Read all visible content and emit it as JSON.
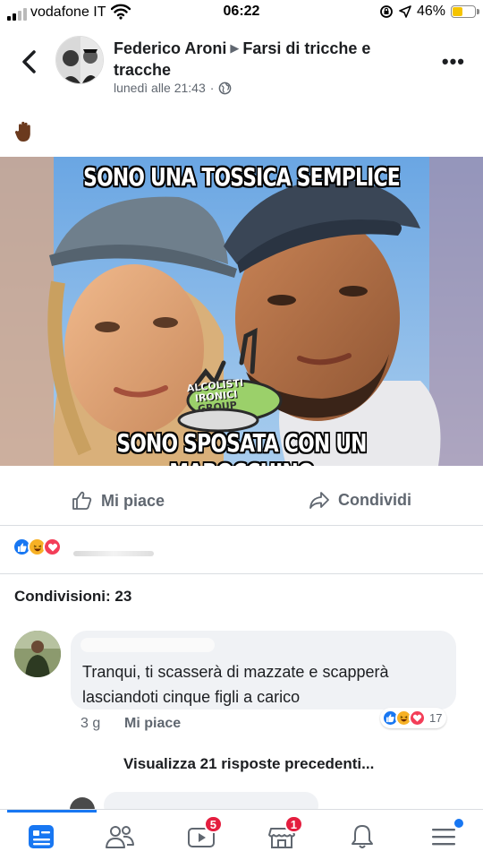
{
  "status_bar": {
    "carrier": "vodafone IT",
    "time": "06:22",
    "battery": "46%",
    "battery_level": 0.46
  },
  "post": {
    "author": "Federico Aroni",
    "group": "Farsi di tricche e tracche",
    "timestamp": "lunedì alle 21:43",
    "privacy_icon": "globe-icon",
    "emoji": "raised-hand-emoji",
    "image": {
      "top_text": "SONO UNA TOSSICA SEMPLICE",
      "bottom_text": "SONO SPOSATA CON UN MAROCCHINO",
      "watermark_line1": "ALCOLISTI",
      "watermark_line2": "IRONICI",
      "watermark_line3": "GROUP"
    }
  },
  "actions": {
    "like_label": "Mi piace",
    "share_label": "Condividi"
  },
  "shares_label": "Condivisioni: 23",
  "comment": {
    "text": "Tranqui, ti scasserà di mazzate e scapperà lasciandoti cinque figli a carico",
    "time": "3 g",
    "like_label": "Mi piace",
    "reaction_count": "17"
  },
  "view_replies": "Visualizza 21 risposte precedenti...",
  "bottom_nav": {
    "watch_badge": "5",
    "marketplace_badge": "1"
  },
  "colors": {
    "accent": "#1877f2",
    "badge": "#e41e3f",
    "battery": "#f5c400"
  }
}
